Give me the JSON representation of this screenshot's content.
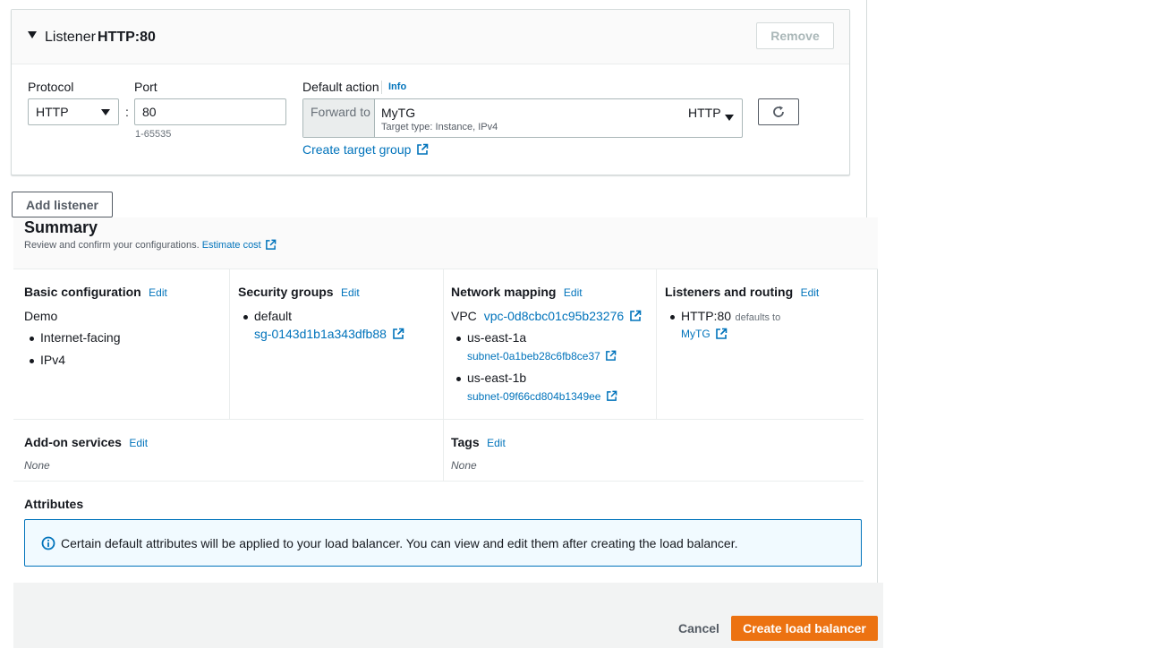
{
  "listener": {
    "title_prefix": "Listener",
    "title_value": "HTTP:80",
    "remove_label": "Remove",
    "protocol_label": "Protocol",
    "protocol_value": "HTTP",
    "colon": ":",
    "port_label": "Port",
    "port_value": "80",
    "port_hint": "1-65535",
    "default_action_label": "Default action",
    "info_label": "Info",
    "forward_to_label": "Forward to",
    "target_group_name": "MyTG",
    "target_group_protocol": "HTTP",
    "target_type_text": "Target type: Instance, IPv4",
    "create_target_group_label": "Create target group",
    "add_listener_label": "Add listener"
  },
  "summary": {
    "title": "Summary",
    "subtitle": "Review and confirm your configurations.",
    "estimate_cost_label": "Estimate cost",
    "edit_label": "Edit",
    "basic": {
      "title": "Basic configuration",
      "name": "Demo",
      "items": [
        "Internet-facing",
        "IPv4"
      ]
    },
    "security": {
      "title": "Security groups",
      "group_name": "default",
      "group_id": "sg-0143d1b1a343dfb88"
    },
    "network": {
      "title": "Network mapping",
      "vpc_label": "VPC",
      "vpc_id": "vpc-0d8cbc01c95b23276",
      "zones": [
        {
          "zone": "us-east-1a",
          "subnet": "subnet-0a1beb28c6fb8ce37"
        },
        {
          "zone": "us-east-1b",
          "subnet": "subnet-09f66cd804b1349ee"
        }
      ]
    },
    "listeners": {
      "title": "Listeners and routing",
      "listener": "HTTP:80",
      "defaults_to": "defaults to",
      "target": "MyTG"
    },
    "addons": {
      "title": "Add-on services",
      "value": "None"
    },
    "tags": {
      "title": "Tags",
      "value": "None"
    },
    "attributes": {
      "title": "Attributes",
      "info_text": "Certain default attributes will be applied to your load balancer. You can view and edit them after creating the load balancer."
    }
  },
  "footer": {
    "cancel_label": "Cancel",
    "create_label": "Create load balancer"
  },
  "colors": {
    "link": "#0073bb",
    "primary_button": "#ec7211",
    "info_bg": "#f1faff",
    "info_border": "#0073bb"
  },
  "icons": [
    "caret-down-icon",
    "external-link-icon",
    "refresh-icon",
    "info-circle-icon"
  ]
}
